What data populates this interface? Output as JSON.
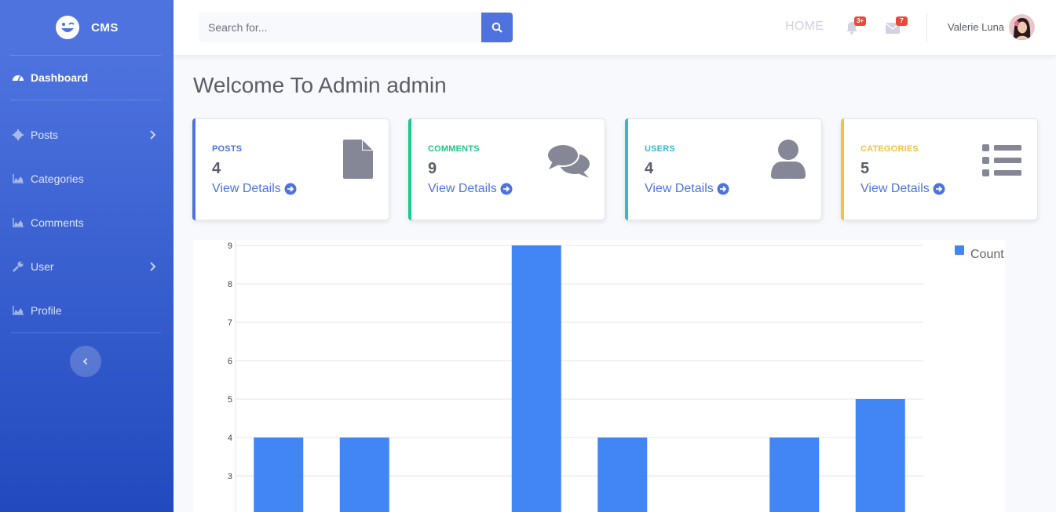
{
  "brand": {
    "name": "CMS"
  },
  "sidebar": {
    "items": [
      {
        "label": "Dashboard",
        "icon": "tachometer-icon",
        "active": true
      },
      {
        "label": "Posts",
        "icon": "gear-icon",
        "has_submenu": true
      },
      {
        "label": "Categories",
        "icon": "area-chart-icon"
      },
      {
        "label": "Comments",
        "icon": "area-chart-icon"
      },
      {
        "label": "User",
        "icon": "wrench-icon",
        "has_submenu": true
      },
      {
        "label": "Profile",
        "icon": "area-chart-icon"
      }
    ],
    "toggle_icon": "chevron-left-icon"
  },
  "topbar": {
    "search_placeholder": "Search for...",
    "home_label": "HOME",
    "alerts_badge": "3+",
    "messages_badge": "7",
    "user_name": "Valerie Luna"
  },
  "main": {
    "title": "Welcome To Admin admin",
    "cards": [
      {
        "label": "POSTS",
        "value": "4",
        "link": "View Details",
        "color": "#4e73df",
        "icon": "file-icon"
      },
      {
        "label": "COMMENTS",
        "value": "9",
        "link": "View Details",
        "color": "#1cc88a",
        "icon": "comments-icon"
      },
      {
        "label": "USERS",
        "value": "4",
        "link": "View Details",
        "color": "#36b9cc",
        "icon": "user-icon"
      },
      {
        "label": "CATEGORIES",
        "value": "5",
        "link": "View Details",
        "color": "#f6c23e",
        "icon": "list-icon"
      }
    ]
  },
  "colors": {
    "primary": "#4e73df",
    "bar": "#4285f4",
    "icon_gray": "#858796"
  },
  "chart_data": {
    "type": "bar",
    "categories": [
      "",
      "",
      "",
      "",
      "",
      "",
      "",
      ""
    ],
    "series": [
      {
        "name": "Count",
        "values": [
          4,
          4,
          0,
          9,
          4,
          0,
          4,
          5
        ]
      }
    ],
    "yticks": [
      3,
      4,
      5,
      6,
      7,
      8,
      9
    ],
    "ylim": [
      2,
      9
    ],
    "grid": true,
    "legend": "top-right"
  }
}
